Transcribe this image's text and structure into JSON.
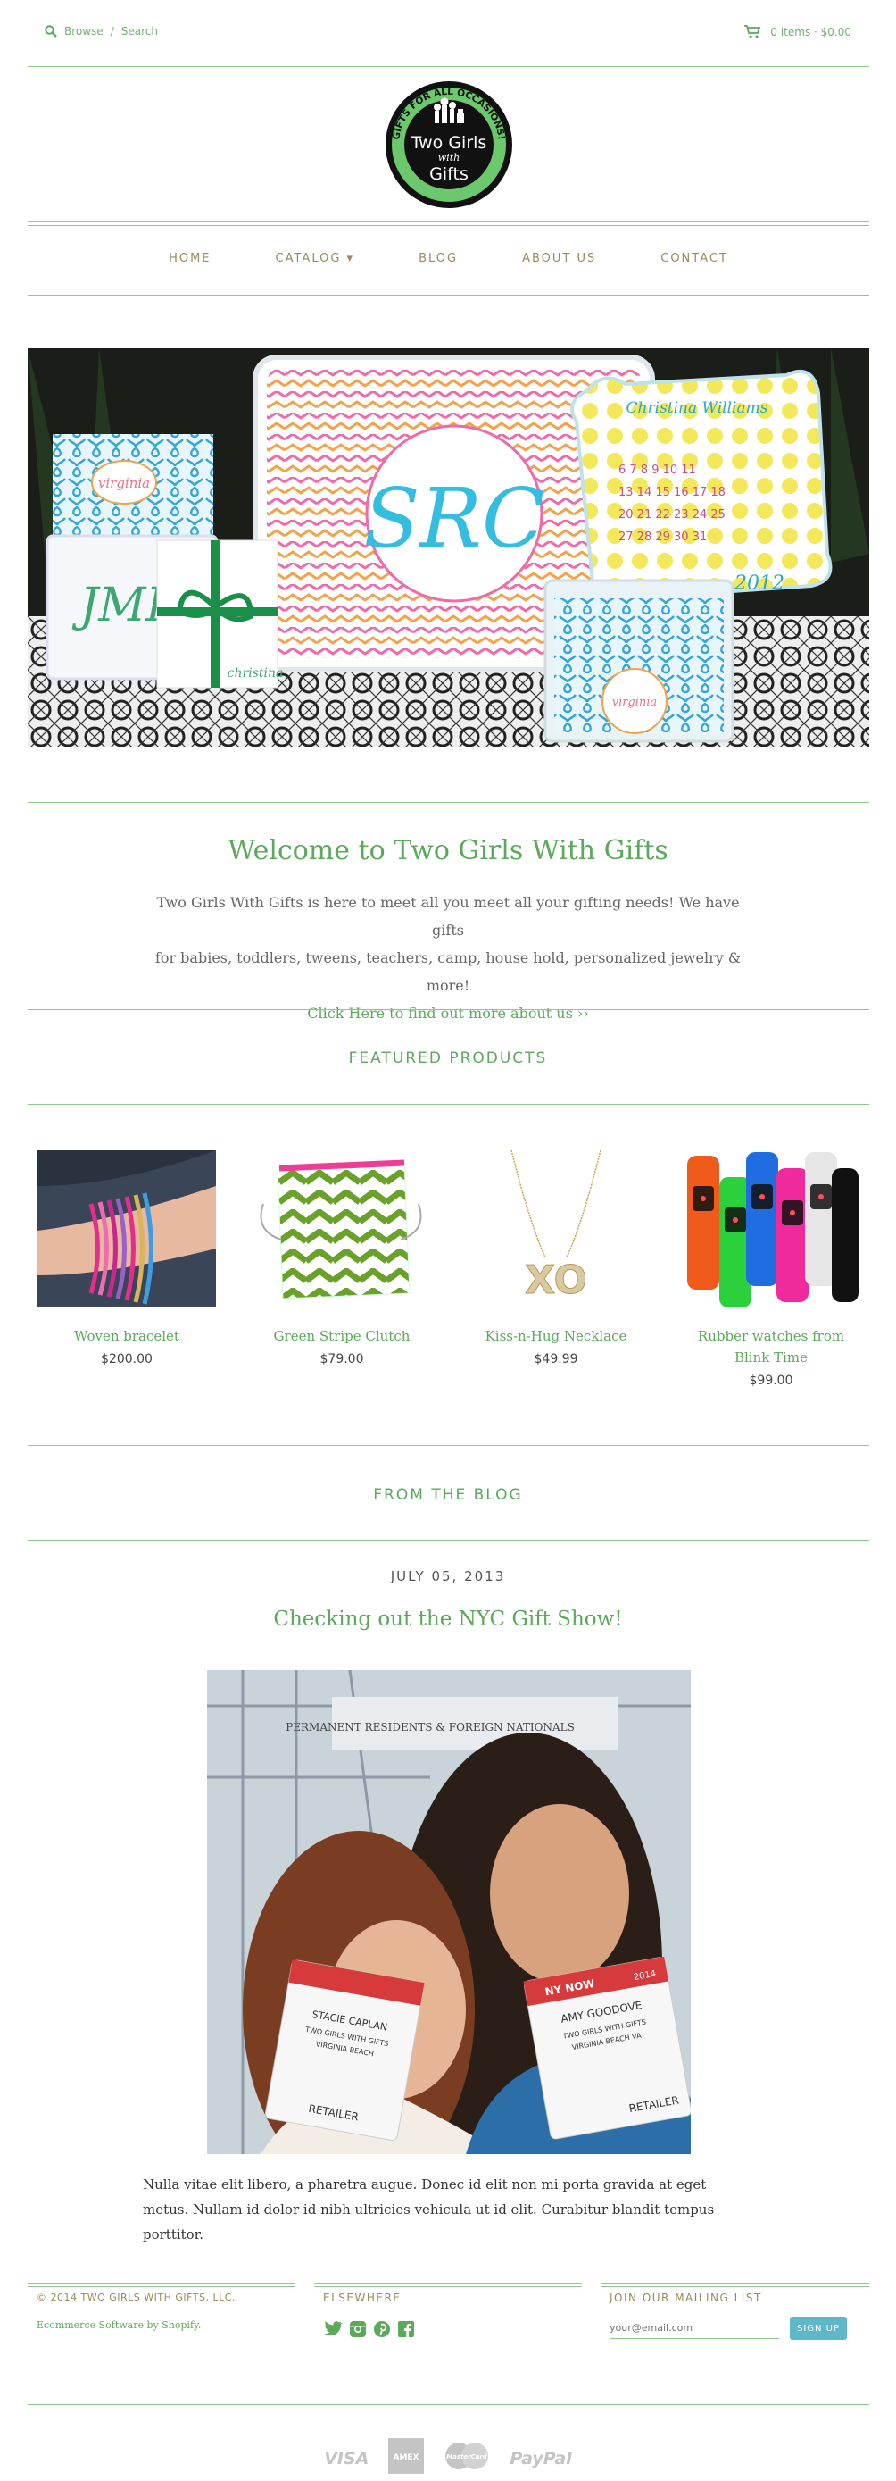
{
  "header": {
    "browse": "Browse",
    "separator": "/",
    "search_label": "Search",
    "cart_text": "0 items  ·  $0.00"
  },
  "logo": {
    "top_text": "GIFTS FOR ALL OCCASIONS!",
    "line1": "Two Girls",
    "line2": "with",
    "line3": "Gifts"
  },
  "nav": {
    "items": [
      "HOME",
      "CATALOG ▾",
      "BLOG",
      "ABOUT US",
      "CONTACT"
    ]
  },
  "hero": {
    "caption_1": "virginia",
    "caption_2": "Christina Williams",
    "caption_3": "2012",
    "caption_4": "christina"
  },
  "welcome": {
    "title": "Welcome to Two Girls With Gifts",
    "line1": "Two Girls With Gifts is here to meet all you meet all your gifting needs! We have gifts",
    "line2": "for babies, toddlers, tweens, teachers, camp, house hold, personalized jewelry & more!",
    "link": "Click Here to find out more about us ››"
  },
  "featured": {
    "title": "FEATURED PRODUCTS",
    "products": [
      {
        "name": "Woven bracelet",
        "price": "$200.00"
      },
      {
        "name": "Green Stripe Clutch",
        "price": "$79.00"
      },
      {
        "name": "Kiss-n-Hug Necklace",
        "price": "$49.99"
      },
      {
        "name": "Rubber watches from Blink Time",
        "price": "$99.00"
      }
    ]
  },
  "blog": {
    "section_title": "FROM THE BLOG",
    "date": "JULY 05, 2013",
    "title": "Checking out the NYC Gift Show!",
    "body": "Nulla vitae elit libero, a pharetra augue. Donec id elit non mi porta gravida at eget metus. Nullam id dolor id nibh ultricies vehicula ut id elit. Curabitur blandit tempus porttitor.",
    "photo_signage": "PERMANENT RESIDENTS & FOREIGN NATIONALS",
    "badge_left_name": "STACIE CAPLAN",
    "badge_left_company": "TWO GIRLS WITH GIFTS",
    "badge_left_city": "VIRGINIA BEACH",
    "badge_left_type": "RETAILER",
    "badge_right_show": "NY NOW",
    "badge_right_year": "2014",
    "badge_right_name": "AMY GOODOVE",
    "badge_right_company": "TWO GIRLS WITH GIFTS",
    "badge_right_city": "VIRGINIA BEACH VA",
    "badge_right_type": "RETAILER"
  },
  "footer": {
    "copyright": "© 2014 TWO GIRLS WITH GIFTS, LLC.",
    "powered": "Ecommerce Software by Shopify.",
    "elsewhere_title": "ELSEWHERE",
    "mailing_title": "JOIN OUR MAILING LIST",
    "email_placeholder": "your@email.com",
    "signup": "SIGN UP",
    "payments": [
      "VISA",
      "AMEX",
      "MasterCard",
      "PayPal"
    ]
  },
  "colors": {
    "accent_green": "#5aaa5a",
    "rule_green": "#8cc98c",
    "nav_gold": "#9a8a5a",
    "signup_blue": "#5fb8c9"
  }
}
